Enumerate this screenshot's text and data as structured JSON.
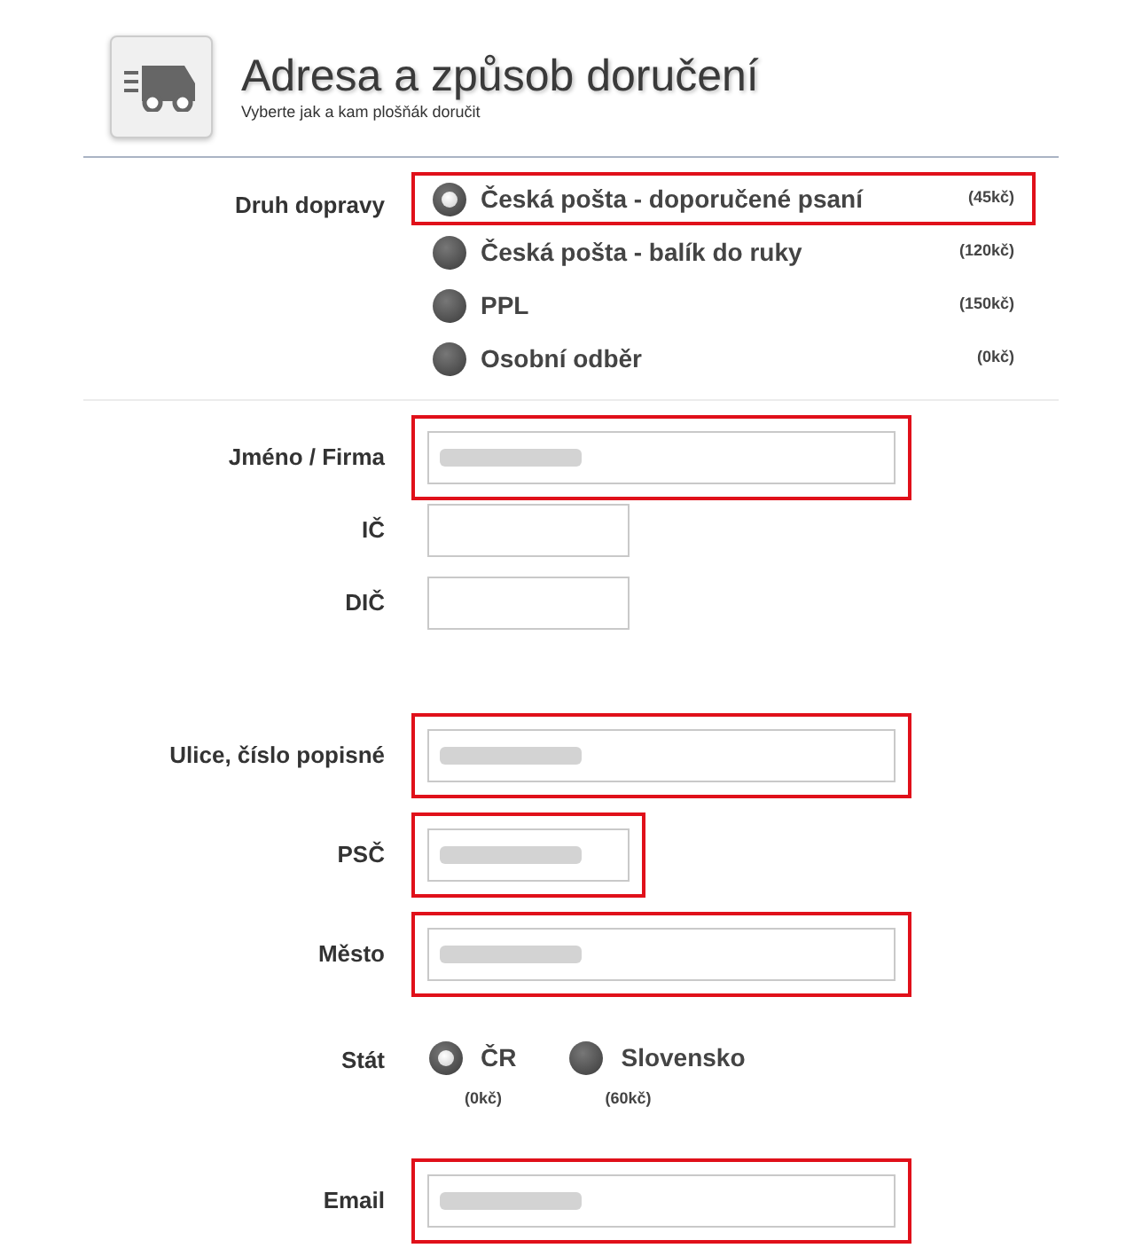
{
  "header": {
    "title": "Adresa a způsob doručení",
    "subtitle": "Vyberte jak a kam plošňák doručit"
  },
  "shipping": {
    "label": "Druh dopravy",
    "options": [
      {
        "label": "Česká pošta - doporučené psaní",
        "price": "(45kč)",
        "selected": true,
        "highlighted": true
      },
      {
        "label": "Česká pošta - balík do ruky",
        "price": "(120kč)",
        "selected": false,
        "highlighted": false
      },
      {
        "label": "PPL",
        "price": "(150kč)",
        "selected": false,
        "highlighted": false
      },
      {
        "label": "Osobní odběr",
        "price": "(0kč)",
        "selected": false,
        "highlighted": false
      }
    ]
  },
  "fields": [
    {
      "label": "Jméno / Firma",
      "kind": "wide",
      "redacted": true,
      "highlighted": true
    },
    {
      "label": "IČ",
      "kind": "short",
      "redacted": false,
      "highlighted": false
    },
    {
      "label": "DIČ",
      "kind": "short",
      "redacted": false,
      "highlighted": false
    },
    {
      "label": "Ulice, číslo popisné",
      "kind": "wide",
      "redacted": true,
      "highlighted": true
    },
    {
      "label": "PSČ",
      "kind": "short",
      "redacted": true,
      "highlighted": true
    },
    {
      "label": "Město",
      "kind": "wide",
      "redacted": true,
      "highlighted": true
    }
  ],
  "country": {
    "label": "Stát",
    "options": [
      {
        "label": "ČR",
        "price": "(0kč)",
        "selected": true
      },
      {
        "label": "Slovensko",
        "price": "(60kč)",
        "selected": false
      }
    ]
  },
  "email": {
    "label": "Email",
    "kind": "wide",
    "redacted": true,
    "highlighted": true
  }
}
